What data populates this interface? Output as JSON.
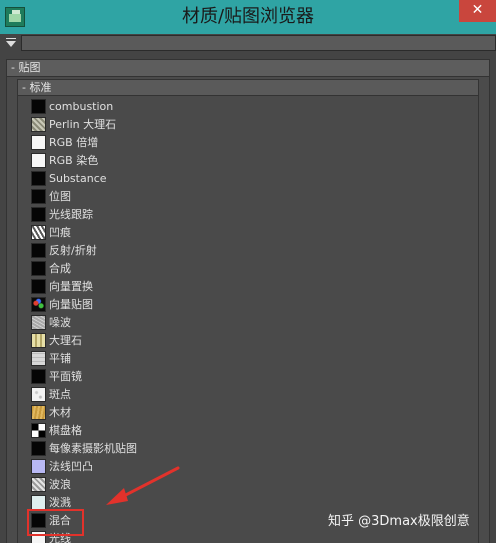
{
  "window": {
    "title": "材质/贴图浏览器",
    "close_glyph": "✕"
  },
  "search": {
    "value": "",
    "placeholder": ""
  },
  "tree": {
    "group_label": "- 贴图",
    "subgroup_label": "- 标准",
    "items": [
      {
        "label": "combustion",
        "swatch": "black"
      },
      {
        "label": "Perlin 大理石",
        "swatch": "perlin"
      },
      {
        "label": "RGB 倍增",
        "swatch": "white"
      },
      {
        "label": "RGB 染色",
        "swatch": "white"
      },
      {
        "label": "Substance",
        "swatch": "black"
      },
      {
        "label": "位图",
        "swatch": "black"
      },
      {
        "label": "光线跟踪",
        "swatch": "black"
      },
      {
        "label": "凹痕",
        "swatch": "dent"
      },
      {
        "label": "反射/折射",
        "swatch": "black"
      },
      {
        "label": "合成",
        "swatch": "black"
      },
      {
        "label": "向量置换",
        "swatch": "black"
      },
      {
        "label": "向量贴图",
        "swatch": "vector"
      },
      {
        "label": "噪波",
        "swatch": "noise"
      },
      {
        "label": "大理石",
        "swatch": "marble"
      },
      {
        "label": "平铺",
        "swatch": "tiles"
      },
      {
        "label": "平面镜",
        "swatch": "black"
      },
      {
        "label": "斑点",
        "swatch": "speckle"
      },
      {
        "label": "木材",
        "swatch": "wood"
      },
      {
        "label": "棋盘格",
        "swatch": "checker"
      },
      {
        "label": "每像素摄影机贴图",
        "swatch": "black"
      },
      {
        "label": "法线凹凸",
        "swatch": "normal"
      },
      {
        "label": "波浪",
        "swatch": "waves"
      },
      {
        "label": "泼溅",
        "swatch": "splat"
      },
      {
        "label": "混合",
        "swatch": "black"
      },
      {
        "label": "光线",
        "swatch": "white"
      }
    ]
  },
  "annotation": {
    "highlight_color": "#e2322b"
  },
  "watermark": {
    "text": "知乎 @3Dmax极限创意"
  }
}
